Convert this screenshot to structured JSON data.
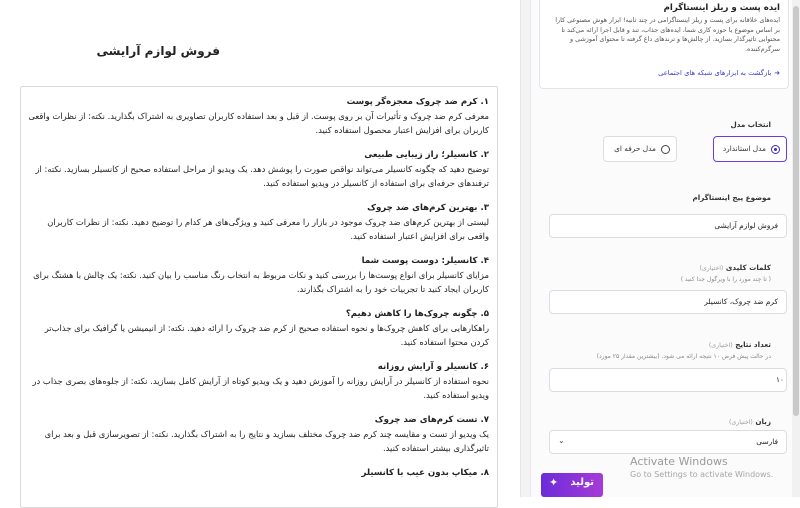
{
  "document": {
    "title": "فروش لوازم آرایشی",
    "items": [
      {
        "heading": "۱. کرم ضد چروک معجزه‌گر پوست",
        "body": "معرفی کرم ضد چروک و تأثیرات آن بر روی پوست. از قبل و بعد استفاده کاربران تصاویری به اشتراک بگذارید. نکته: از نظرات واقعی کاربران برای افزایش اعتبار محصول استفاده کنید."
      },
      {
        "heading": "۲. کانسیلر؛ راز زیبایی طبیعی",
        "body": "توضیح دهید که چگونه کانسیلر می‌تواند نواقص صورت را پوشش دهد. یک ویدیو از مراحل استفاده صحیح از کانسیلر بسازید. نکته: از ترفندهای حرفه‌ای برای استفاده از کانسیلر در ویدیو استفاده کنید."
      },
      {
        "heading": "۳. بهترین کرم‌های ضد چروک",
        "body": "لیستی از بهترین کرم‌های ضد چروک موجود در بازار را معرفی کنید و ویژگی‌های هر کدام را توضیح دهید. نکته: از نظرات کاربران واقعی برای افزایش اعتبار استفاده کنید."
      },
      {
        "heading": "۴. کانسیلر: دوست پوست شما",
        "body": "مزایای کانسیلر برای انواع پوست‌ها را بررسی کنید و نکات مربوط به انتخاب رنگ مناسب را بیان کنید. نکته: یک چالش با هشتگ برای کاربران ایجاد کنید تا تجربیات خود را به اشتراک بگذارند."
      },
      {
        "heading": "۵. چگونه چروک‌ها را کاهش دهیم؟",
        "body": "راهکارهایی برای کاهش چروک‌ها و نحوه استفاده صحیح از کرم ضد چروک را ارائه دهید. نکته: از انیمیشن یا گرافیک برای جذاب‌تر کردن محتوا استفاده کنید."
      },
      {
        "heading": "۶. کانسیلر و آرایش روزانه",
        "body": "نحوه استفاده از کانسیلر در آرایش روزانه را آموزش دهید و یک ویدیو کوتاه از آرایش کامل بسازید. نکته: از جلوه‌های بصری جذاب در ویدیو استفاده کنید."
      },
      {
        "heading": "۷. تست کرم‌های ضد چروک",
        "body": "یک ویدیو از تست و مقایسه چند کرم ضد چروک مختلف بسازید و نتایج را به اشتراک بگذارید. نکته: از تصویرسازی قبل و بعد برای تاثیرگذاری بیشتر استفاده کنید."
      },
      {
        "heading": "۸. میکاپ بدون عیب با کانسیلر",
        "body": ""
      }
    ]
  },
  "sidebar": {
    "info_title": "ایده پست و ریلز اینستاگرام",
    "info_desc": "ایده‌های خلاقانه برای پست و ریلز اینستاگرامی در چند ثانیه! ابزار هوش مصنوعی کارا بر اساس موضوع یا حوزه کاری شما، ایده‌های جذاب، تند و قابل اجرا ارائه می‌کند تا محتوایی تاثیرگذار بسازید. از چالش‌ها و ترندهای داغ گرفته تا محتوای آموزشی و سرگرم‌کننده.",
    "back_link": "بازگشت به ابزارهای شبکه های اجتماعی",
    "model_label": "انتخاب مدل",
    "model_options": [
      "مدل استاندارد",
      "مدل حرفه ای"
    ],
    "topic_label": "موضوع پیج اینستاگرام",
    "topic_value": "فروش لوازم آرایشی",
    "keywords_label": "کلمات کلیدی",
    "optional": "(اختیاری)",
    "keywords_hint": "( تا چند مورد را با ویرگول جدا کنید )",
    "keywords_value": "کرم ضد چروک، کانسیلر",
    "count_label": "تعداد نتایج",
    "count_hint": "در حالت پیش فرض ۱۰ نتیجه ارائه می شود. (بیشترین مقدار ۲۵ مورد)",
    "count_value": "۱۰",
    "lang_label": "زبان",
    "lang_value": "فارسی",
    "generate_label": "تولید"
  },
  "overlay": {
    "watermark_title": "Activate Windows",
    "watermark_sub": "Go to Settings to activate Windows."
  },
  "colors": {
    "accent": "#6c2bd9",
    "link": "#3a3ad0",
    "radio_on": "#3c2bb8"
  },
  "icons": {
    "back": "arrow-icon",
    "generate": "sparkle-icon",
    "lang": "chevron-down-icon"
  }
}
